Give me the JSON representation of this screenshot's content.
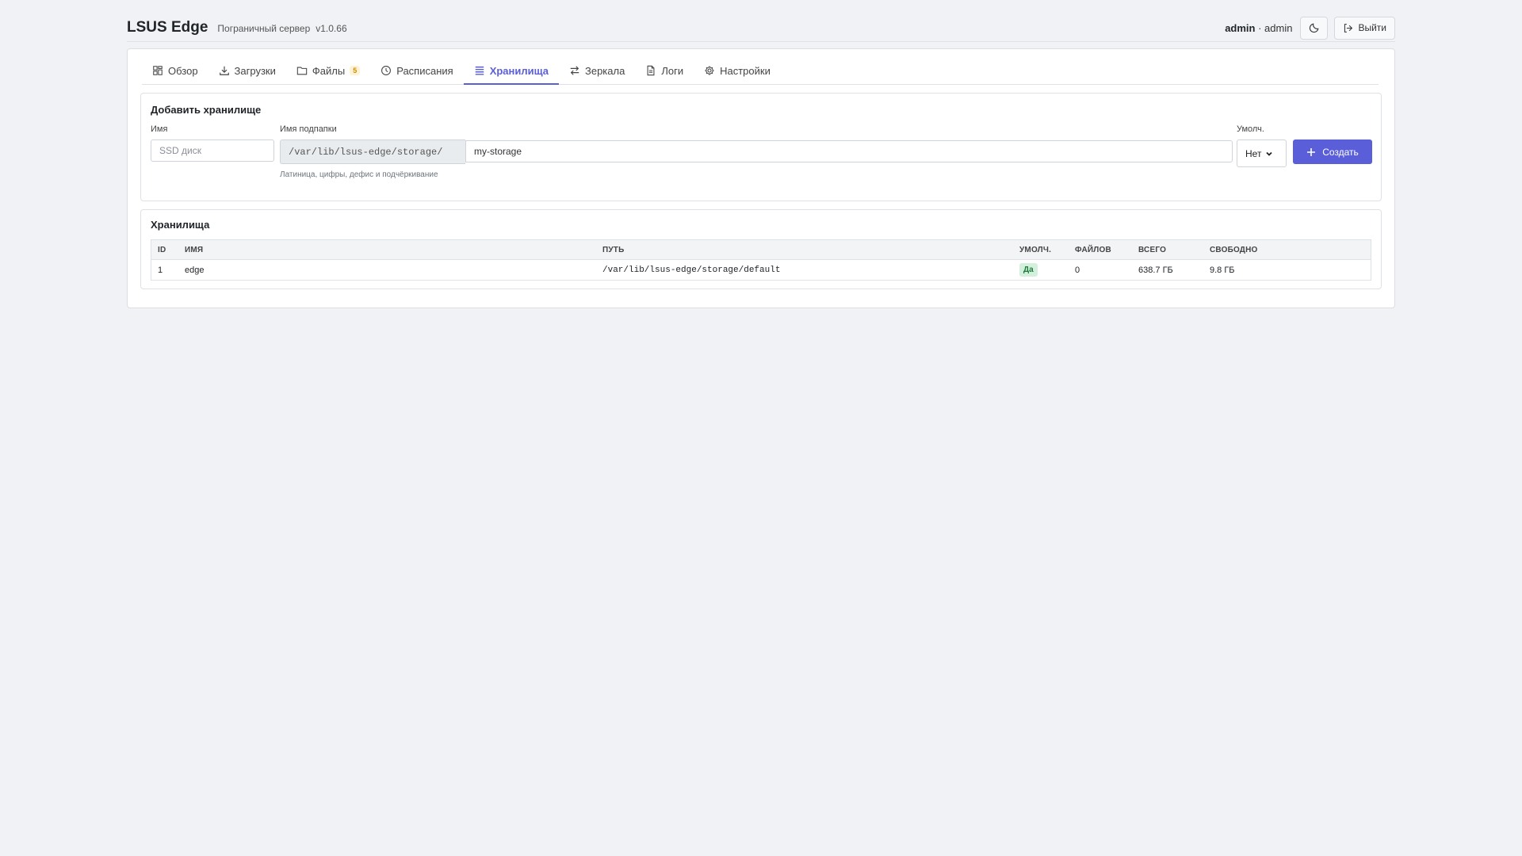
{
  "header": {
    "title": "LSUS Edge",
    "subtitle": "Пограничный сервер",
    "version": "v1.0.66",
    "user_name": "admin",
    "user_role": "admin",
    "theme_icon": "moon-icon",
    "logout_label": "Выйти"
  },
  "tabs": [
    {
      "label": "Обзор",
      "icon": "grid-icon"
    },
    {
      "label": "Загрузки",
      "icon": "download-icon"
    },
    {
      "label": "Файлы",
      "icon": "folder-icon",
      "badge": "5"
    },
    {
      "label": "Расписания",
      "icon": "clock-icon"
    },
    {
      "label": "Хранилища",
      "icon": "list-icon",
      "active": true
    },
    {
      "label": "Зеркала",
      "icon": "swap-icon"
    },
    {
      "label": "Логи",
      "icon": "file-icon"
    },
    {
      "label": "Настройки",
      "icon": "gear-icon"
    }
  ],
  "add_form": {
    "title": "Добавить хранилище",
    "name_label": "Имя",
    "name_placeholder": "SSD диск",
    "subfolder_label": "Имя подпапки",
    "path_prefix": "/var/lib/lsus-edge/storage/",
    "subfolder_value": "my-storage",
    "subfolder_help": "Латиница, цифры, дефис и подчёркивание",
    "default_label": "Умолч.",
    "default_value": "Нет",
    "create_label": "Создать"
  },
  "storages": {
    "title": "Хранилища",
    "columns": [
      "ID",
      "ИМЯ",
      "ПУТЬ",
      "УМОЛЧ.",
      "ФАЙЛОВ",
      "ВСЕГО",
      "СВОБОДНО"
    ],
    "rows": [
      {
        "id": "1",
        "name": "edge",
        "path": "/var/lib/lsus-edge/storage/default",
        "default": "Да",
        "files": "0",
        "total": "638.7 ГБ",
        "free": "9.8 ГБ"
      }
    ]
  },
  "colors": {
    "accent": "#5a5ed8",
    "background": "#f1f2f6",
    "success_badge": "#d3f0dc",
    "warning_badge": "#fff3d6"
  }
}
